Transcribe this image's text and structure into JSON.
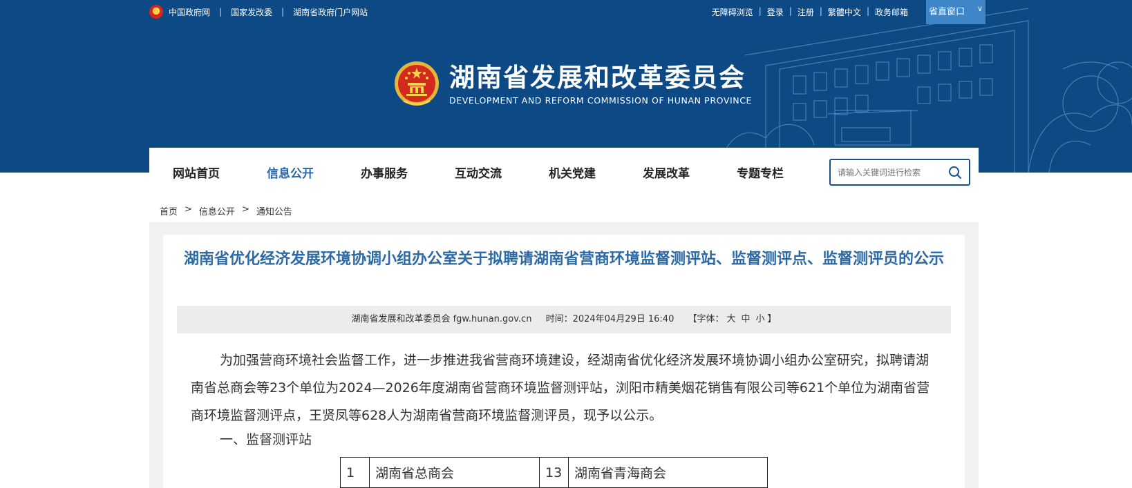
{
  "topbar": {
    "left_links": [
      "中国政府网",
      "国家发改委",
      "湖南省政府门户网站"
    ],
    "right_links": [
      "无障碍浏览",
      "登录",
      "注册",
      "繁體中文",
      "政务邮箱"
    ],
    "dept_window": "省直窗口"
  },
  "brand": {
    "title": "湖南省发展和改革委员会",
    "subtitle": "DEVELOPMENT AND REFORM COMMISSION OF HUNAN PROVINCE"
  },
  "nav": {
    "items": [
      "网站首页",
      "信息公开",
      "办事服务",
      "互动交流",
      "机关党建",
      "发展改革",
      "专题专栏"
    ],
    "active_index": 1
  },
  "search": {
    "placeholder": "请输入关键词进行检索"
  },
  "breadcrumb": [
    "首页",
    "信息公开",
    "通知公告"
  ],
  "article": {
    "title": "湖南省优化经济发展环境协调小组办公室关于拟聘请湖南省营商环境监督测评站、监督测评点、监督测评员的公示",
    "meta": {
      "source": "湖南省发展和改革委员会 fgw.hunan.gov.cn",
      "time": "时间：2024年04月29日 16:40",
      "font_label": "【字体：",
      "font_sizes": [
        "大",
        "中",
        "小"
      ],
      "font_end": "】"
    },
    "paragraph": "为加强营商环境社会监督工作，进一步推进我省营商环境建设，经湖南省优化经济发展环境协调小组办公室研究，拟聘请湖南省总商会等23个单位为2024—2026年度湖南省营商环境监督测评站，浏阳市精美烟花销售有限公司等621个单位为湖南省营商环境监督测评点，王贤凤等628人为湖南省营商环境监督测评员，现予以公示。",
    "section_1": "一、监督测评站",
    "table_rows": [
      [
        "1",
        "湖南省总商会",
        "13",
        "湖南省青海商会"
      ]
    ]
  },
  "colors": {
    "header_bg": "#0d4a85",
    "nav_active": "#2b66a8",
    "title": "#2c6aa6",
    "dept_window_bg": "#3f86c8"
  }
}
